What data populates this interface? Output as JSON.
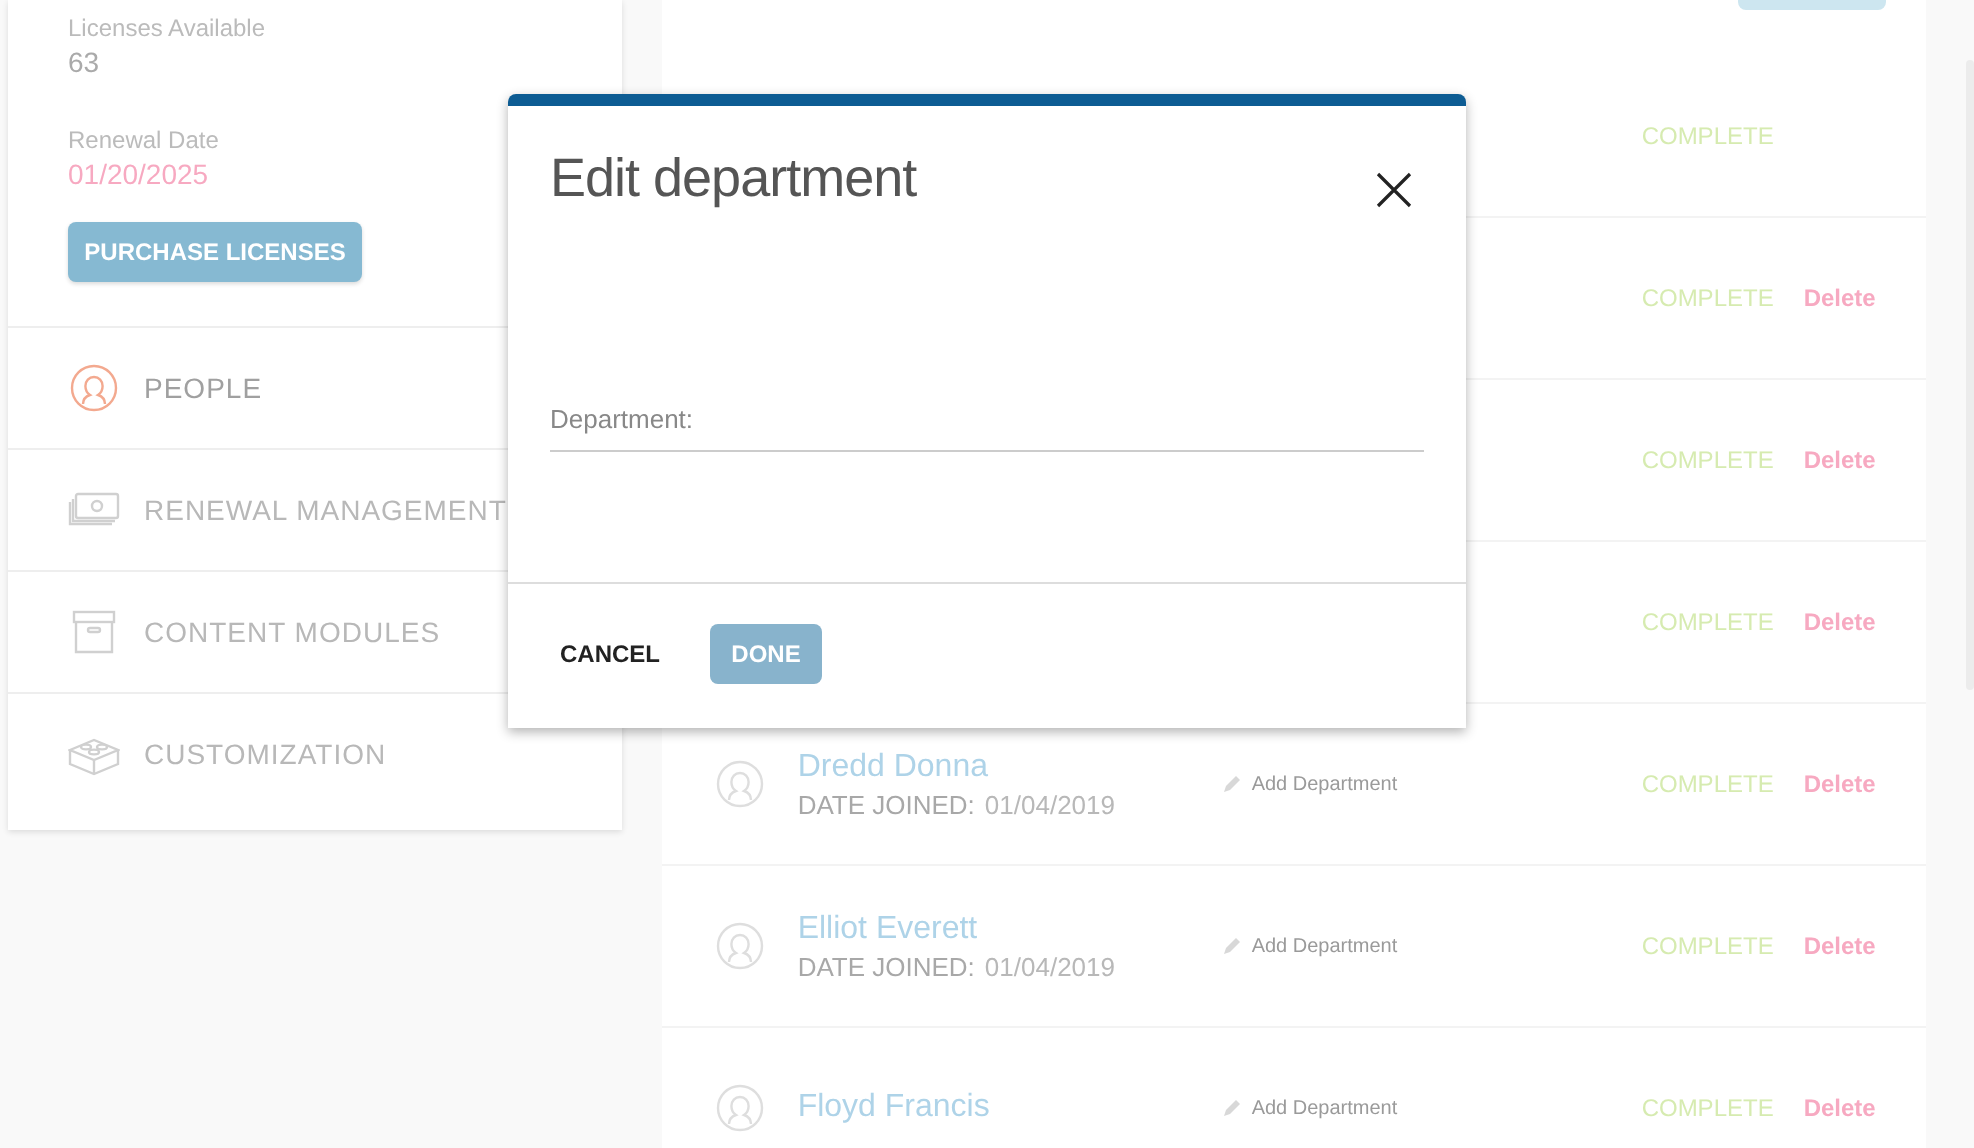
{
  "sidebar": {
    "stats": [
      {
        "label": "Licenses Available",
        "value": "63",
        "kind": "plain"
      },
      {
        "label": "Renewal Date",
        "value": "01/20/2025",
        "kind": "alert"
      }
    ],
    "purchase_button": "PURCHASE LICENSES",
    "nav": [
      {
        "label": "PEOPLE",
        "selected": true
      },
      {
        "label": "RENEWAL MANAGEMENT",
        "selected": false
      },
      {
        "label": "CONTENT MODULES",
        "selected": false
      },
      {
        "label": "CUSTOMIZATION",
        "selected": false
      }
    ]
  },
  "people": {
    "rows": [
      {
        "status": "COMPLETE"
      },
      {
        "status": "COMPLETE",
        "action": "Delete"
      },
      {
        "status": "COMPLETE",
        "action": "Delete"
      },
      {
        "status": "COMPLETE",
        "action": "Delete"
      },
      {
        "name": "Dredd Donna",
        "date_label": "DATE JOINED:",
        "date": "01/04/2019",
        "department": "Add Department",
        "status": "COMPLETE",
        "action": "Delete"
      },
      {
        "name": "Elliot Everett",
        "date_label": "DATE JOINED:",
        "date": "01/04/2019",
        "department": "Add Department",
        "status": "COMPLETE",
        "action": "Delete"
      },
      {
        "name": "Floyd Francis",
        "department": "Add Department",
        "status": "COMPLETE",
        "action": "Delete"
      }
    ]
  },
  "dialog": {
    "title": "Edit department",
    "field": {
      "placeholder": "Department:"
    },
    "buttons": [
      {
        "label": "CANCEL",
        "kind": "text"
      },
      {
        "label": "DONE",
        "kind": "primary"
      }
    ]
  }
}
